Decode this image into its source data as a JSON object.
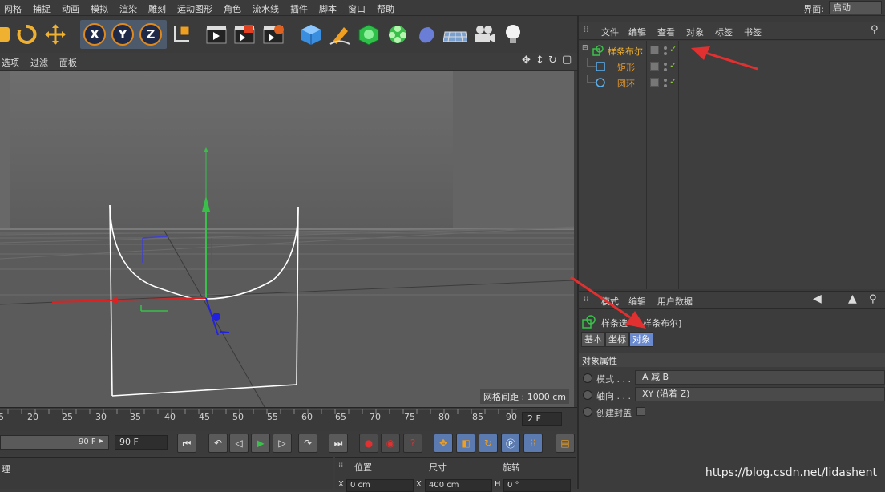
{
  "menu": {
    "items": [
      "网格",
      "捕捉",
      "动画",
      "模拟",
      "渲染",
      "雕刻",
      "运动图形",
      "角色",
      "流水线",
      "插件",
      "脚本",
      "窗口",
      "帮助"
    ],
    "layout_label": "界面:",
    "layout_value": "启动"
  },
  "toolbar": {
    "axis_x": "X",
    "axis_y": "Y",
    "axis_z": "Z"
  },
  "viewport": {
    "menu": [
      "选项",
      "过滤",
      "面板"
    ],
    "grid_distance": "网格间距 : 1000 cm"
  },
  "timeline": {
    "ticks": [
      "5",
      "20",
      "25",
      "30",
      "35",
      "40",
      "45",
      "50",
      "55",
      "60",
      "65",
      "70",
      "75",
      "80",
      "85",
      "90"
    ],
    "current_frame": "2 F",
    "end_frame_slider": "90 F",
    "end_frame_field": "90 F"
  },
  "bottom": {
    "left_label": "理",
    "coords_headers": [
      "位置",
      "尺寸",
      "旋转"
    ],
    "pos_x": "0 cm",
    "size_x_label": "X",
    "size_x": "400 cm",
    "rot_h_label": "H",
    "rot_h": "0 °",
    "pos_x_label": "X"
  },
  "object_manager": {
    "menu": [
      "文件",
      "编辑",
      "查看",
      "对象",
      "标签",
      "书签"
    ],
    "objects": [
      {
        "name": "样条布尔",
        "color": "#f0b030"
      },
      {
        "name": "矩形",
        "color": "#e59a30"
      },
      {
        "name": "圆环",
        "color": "#e59a30"
      }
    ]
  },
  "attribute_manager": {
    "menu": [
      "模式",
      "编辑",
      "用户数据"
    ],
    "object_title_prefix": "样条选",
    "object_title_suffix": "样条布尔]",
    "tabs": [
      "基本",
      "坐标",
      "对象"
    ],
    "section": "对象属性",
    "props": [
      {
        "label": "模式 . . .",
        "value": "A 减 B"
      },
      {
        "label": "轴向 . . .",
        "value": "XY (沿着 Z)"
      },
      {
        "label": "创建封盖",
        "value": ""
      }
    ]
  },
  "watermark": "https://blog.csdn.net/lidashent"
}
